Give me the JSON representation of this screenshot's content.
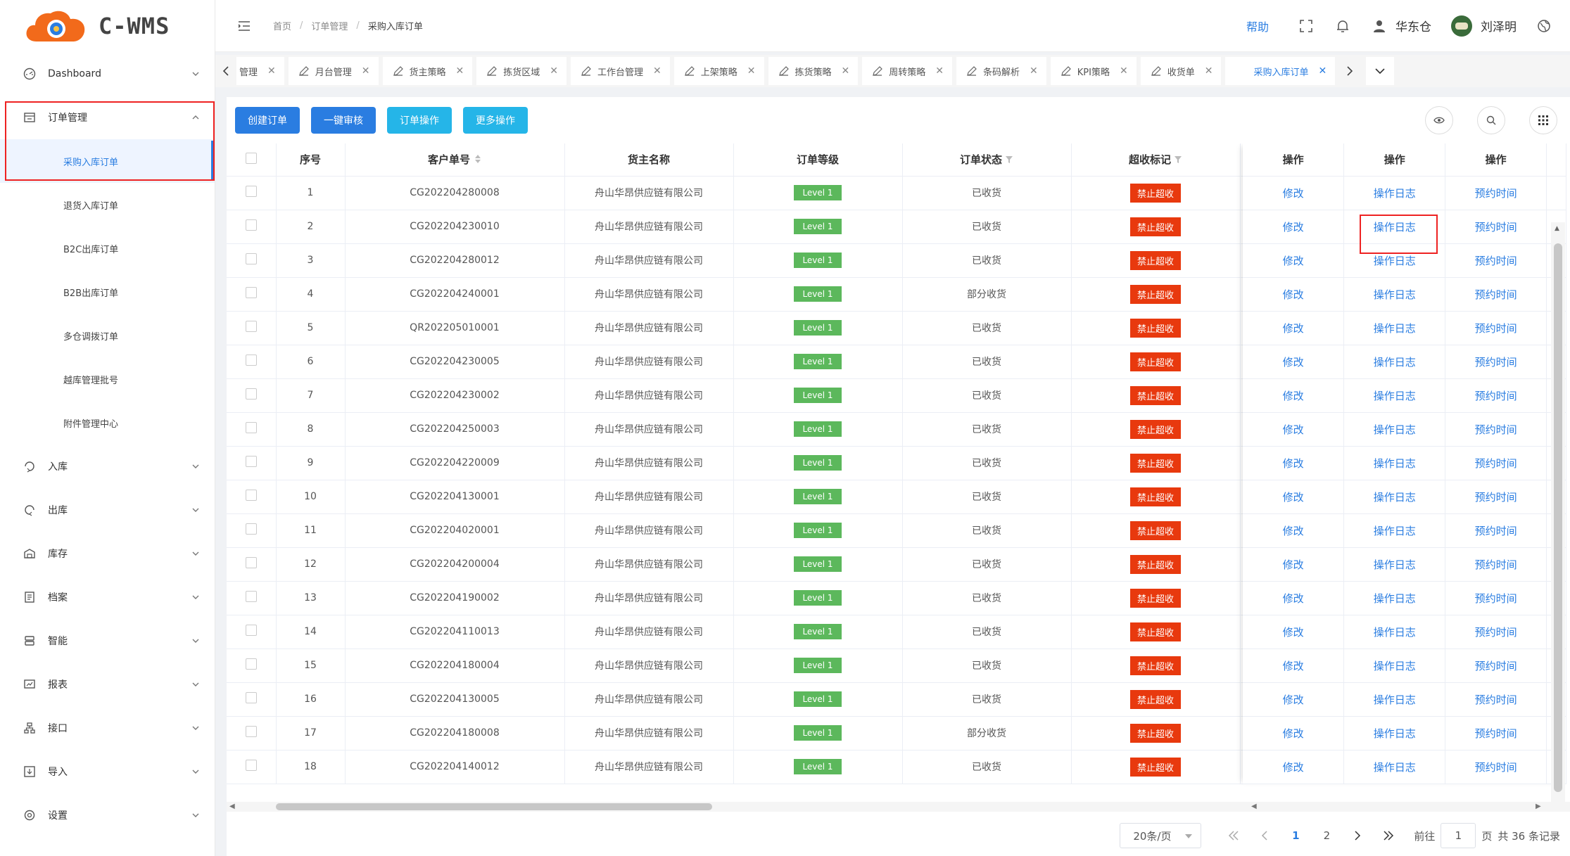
{
  "app": {
    "logo_text": "C-WMS"
  },
  "header": {
    "breadcrumb": [
      "首页",
      "订单管理",
      "采购入库订单"
    ],
    "help": "帮助",
    "warehouse": "华东仓",
    "user": "刘泽明"
  },
  "sidebar": {
    "items": [
      {
        "label": "Dashboard",
        "icon": "dashboard-icon"
      },
      {
        "label": "订单管理",
        "icon": "order-icon",
        "expanded": true
      },
      {
        "label": "入库",
        "icon": "inbound-icon"
      },
      {
        "label": "出库",
        "icon": "outbound-icon"
      },
      {
        "label": "库存",
        "icon": "inventory-icon"
      },
      {
        "label": "档案",
        "icon": "archive-icon"
      },
      {
        "label": "智能",
        "icon": "smart-icon"
      },
      {
        "label": "报表",
        "icon": "report-icon"
      },
      {
        "label": "接口",
        "icon": "interface-icon"
      },
      {
        "label": "导入",
        "icon": "import-icon"
      },
      {
        "label": "设置",
        "icon": "settings-icon"
      }
    ],
    "sub_items": [
      "采购入库订单",
      "退货入库订单",
      "B2C出库订单",
      "B2B出库订单",
      "多仓调拨订单",
      "越库管理批号",
      "附件管理中心"
    ]
  },
  "tabs": [
    {
      "label": "管理"
    },
    {
      "label": "月台管理"
    },
    {
      "label": "货主策略"
    },
    {
      "label": "拣货区域"
    },
    {
      "label": "工作台管理"
    },
    {
      "label": "上架策略"
    },
    {
      "label": "拣货策略"
    },
    {
      "label": "周转策略"
    },
    {
      "label": "条码解析"
    },
    {
      "label": "KPI策略"
    },
    {
      "label": "收货单"
    },
    {
      "label": "采购入库订单",
      "active": true
    }
  ],
  "toolbar": {
    "create": "创建订单",
    "audit": "一键审核",
    "order_ops": "订单操作",
    "more_ops": "更多操作"
  },
  "table": {
    "columns": {
      "index": "序号",
      "customer_no": "客户单号",
      "owner": "货主名称",
      "level": "订单等级",
      "status": "订单状态",
      "over": "超收标记",
      "op1": "操作",
      "op2": "操作",
      "op3": "操作"
    },
    "actions": {
      "edit": "修改",
      "log": "操作日志",
      "appointment": "预约时间"
    },
    "rows": [
      {
        "index": "1",
        "customer_no": "CG202204280008",
        "owner": "舟山华昂供应链有限公司",
        "level": "Level 1",
        "status": "已收货",
        "over": "禁止超收"
      },
      {
        "index": "2",
        "customer_no": "CG202204230010",
        "owner": "舟山华昂供应链有限公司",
        "level": "Level 1",
        "status": "已收货",
        "over": "禁止超收"
      },
      {
        "index": "3",
        "customer_no": "CG202204280012",
        "owner": "舟山华昂供应链有限公司",
        "level": "Level 1",
        "status": "已收货",
        "over": "禁止超收"
      },
      {
        "index": "4",
        "customer_no": "CG202204240001",
        "owner": "舟山华昂供应链有限公司",
        "level": "Level 1",
        "status": "部分收货",
        "over": "禁止超收"
      },
      {
        "index": "5",
        "customer_no": "QR202205010001",
        "owner": "舟山华昂供应链有限公司",
        "level": "Level 1",
        "status": "已收货",
        "over": "禁止超收"
      },
      {
        "index": "6",
        "customer_no": "CG202204230005",
        "owner": "舟山华昂供应链有限公司",
        "level": "Level 1",
        "status": "已收货",
        "over": "禁止超收"
      },
      {
        "index": "7",
        "customer_no": "CG202204230002",
        "owner": "舟山华昂供应链有限公司",
        "level": "Level 1",
        "status": "已收货",
        "over": "禁止超收"
      },
      {
        "index": "8",
        "customer_no": "CG202204250003",
        "owner": "舟山华昂供应链有限公司",
        "level": "Level 1",
        "status": "已收货",
        "over": "禁止超收"
      },
      {
        "index": "9",
        "customer_no": "CG202204220009",
        "owner": "舟山华昂供应链有限公司",
        "level": "Level 1",
        "status": "已收货",
        "over": "禁止超收"
      },
      {
        "index": "10",
        "customer_no": "CG202204130001",
        "owner": "舟山华昂供应链有限公司",
        "level": "Level 1",
        "status": "已收货",
        "over": "禁止超收"
      },
      {
        "index": "11",
        "customer_no": "CG202204020001",
        "owner": "舟山华昂供应链有限公司",
        "level": "Level 1",
        "status": "已收货",
        "over": "禁止超收"
      },
      {
        "index": "12",
        "customer_no": "CG202204200004",
        "owner": "舟山华昂供应链有限公司",
        "level": "Level 1",
        "status": "已收货",
        "over": "禁止超收"
      },
      {
        "index": "13",
        "customer_no": "CG202204190002",
        "owner": "舟山华昂供应链有限公司",
        "level": "Level 1",
        "status": "已收货",
        "over": "禁止超收"
      },
      {
        "index": "14",
        "customer_no": "CG202204110013",
        "owner": "舟山华昂供应链有限公司",
        "level": "Level 1",
        "status": "已收货",
        "over": "禁止超收"
      },
      {
        "index": "15",
        "customer_no": "CG202204180004",
        "owner": "舟山华昂供应链有限公司",
        "level": "Level 1",
        "status": "已收货",
        "over": "禁止超收"
      },
      {
        "index": "16",
        "customer_no": "CG202204130005",
        "owner": "舟山华昂供应链有限公司",
        "level": "Level 1",
        "status": "已收货",
        "over": "禁止超收"
      },
      {
        "index": "17",
        "customer_no": "CG202204180008",
        "owner": "舟山华昂供应链有限公司",
        "level": "Level 1",
        "status": "部分收货",
        "over": "禁止超收"
      },
      {
        "index": "18",
        "customer_no": "CG202204140012",
        "owner": "舟山华昂供应链有限公司",
        "level": "Level 1",
        "status": "已收货",
        "over": "禁止超收"
      }
    ]
  },
  "pagination": {
    "page_size": "20条/页",
    "pages": [
      "1",
      "2"
    ],
    "current": "1",
    "goto_label": "前往",
    "goto_value": "1",
    "page_unit": "页",
    "total": "共 36 条记录"
  }
}
